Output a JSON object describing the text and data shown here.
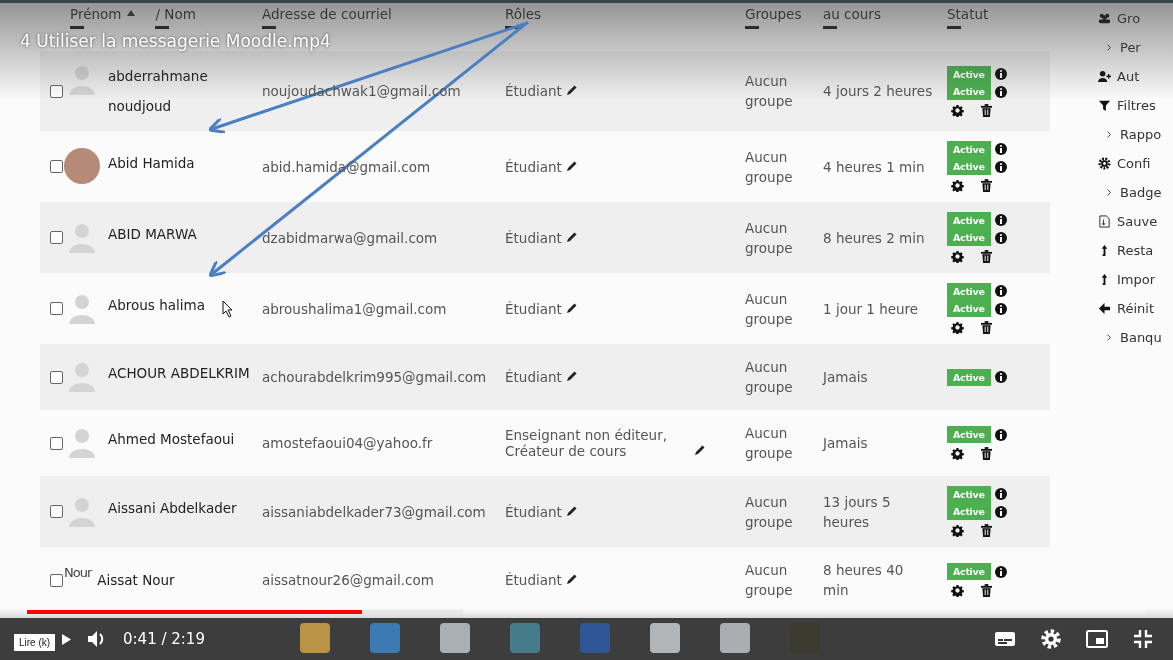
{
  "video": {
    "title": "4 Utiliser la messagerie Moodle.mp4"
  },
  "table": {
    "columns": [
      {
        "label": "Prénom",
        "sorted": true
      },
      {
        "label": "/ Nom",
        "sorted": false
      },
      {
        "label": "Adresse de courriel",
        "sorted": false
      },
      {
        "label": "Rôles",
        "sorted": false
      },
      {
        "label": "Groupes",
        "sorted": false
      },
      {
        "label": "au cours",
        "sorted": false
      },
      {
        "label": "Statut",
        "sorted": false
      }
    ],
    "rows": [
      {
        "checked": false,
        "avatar": {
          "kind": "blank"
        },
        "name": "abderrahmane noudjoud",
        "email": "noujoudachwak1@gmail.com",
        "role": "Étudiant",
        "group": "Aucun groupe",
        "last_access": "4 jours 2 heures",
        "statuses": [
          "Active",
          "Active"
        ],
        "actions": true
      },
      {
        "checked": false,
        "avatar": {
          "kind": "photo"
        },
        "name": "Abid Hamida",
        "email": "abid.hamida@gmail.com",
        "role": "Étudiant",
        "group": "Aucun groupe",
        "last_access": "4 heures 1 min",
        "statuses": [
          "Active",
          "Active"
        ],
        "actions": true
      },
      {
        "checked": false,
        "avatar": {
          "kind": "blank"
        },
        "name": "ABID MARWA",
        "email": "dzabidmarwa@gmail.com",
        "role": "Étudiant",
        "group": "Aucun groupe",
        "last_access": "8 heures 2 min",
        "statuses": [
          "Active",
          "Active"
        ],
        "actions": true
      },
      {
        "checked": false,
        "avatar": {
          "kind": "blank"
        },
        "name": "Abrous halima",
        "email": "abroushalima1@gmail.com",
        "role": "Étudiant",
        "group": "Aucun groupe",
        "last_access": "1 jour 1 heure",
        "statuses": [
          "Active",
          "Active"
        ],
        "actions": true
      },
      {
        "checked": false,
        "avatar": {
          "kind": "blank"
        },
        "name": "ACHOUR ABDELKRIM",
        "email": "achourabdelkrim995@gmail.com",
        "role": "Étudiant",
        "group": "Aucun groupe",
        "last_access": "Jamais",
        "statuses": [
          "Active"
        ],
        "actions": false
      },
      {
        "checked": false,
        "avatar": {
          "kind": "blank"
        },
        "name": "Ahmed Mostefaoui",
        "email": "amostefaoui04@yahoo.fr",
        "role": "Enseignant non éditeur, Créateur de cours",
        "group": "Aucun groupe",
        "last_access": "Jamais",
        "statuses": [
          "Active"
        ],
        "actions": true
      },
      {
        "checked": false,
        "avatar": {
          "kind": "blank"
        },
        "name": "Aissani Abdelkader",
        "email": "aissaniabdelkader73@gmail.com",
        "role": "Étudiant",
        "group": "Aucun groupe",
        "last_access": "13 jours 5 heures",
        "statuses": [
          "Active",
          "Active"
        ],
        "actions": true
      },
      {
        "checked": false,
        "avatar": {
          "kind": "text",
          "text": "Nour"
        },
        "name": "Aissat Nour",
        "email": "aissatnour26@gmail.com",
        "role": "Étudiant",
        "group": "Aucun groupe",
        "last_access": "8 heures 40 min",
        "statuses": [
          "Active"
        ],
        "actions": true
      }
    ]
  },
  "sidebar": {
    "items": [
      {
        "kind": "people",
        "label": "Gro"
      },
      {
        "kind": "chevron",
        "label": "Per"
      },
      {
        "kind": "adduser",
        "label": "Aut"
      },
      {
        "kind": "filter",
        "label": "Filtres"
      },
      {
        "kind": "chevron",
        "label": "Rappo"
      },
      {
        "kind": "gear",
        "label": "Confi"
      },
      {
        "kind": "chevron",
        "label": "Badge"
      },
      {
        "kind": "file",
        "label": "Sauve"
      },
      {
        "kind": "up",
        "label": "Resta"
      },
      {
        "kind": "up",
        "label": "Impor"
      },
      {
        "kind": "back",
        "label": "Réinit"
      },
      {
        "kind": "chevron",
        "label": "Banqu"
      }
    ]
  },
  "player": {
    "tooltip": "Lire (k)",
    "time": "0:41 / 2:19",
    "progress": {
      "level": 0.3
    },
    "buffer": {
      "level": 0.39
    }
  }
}
